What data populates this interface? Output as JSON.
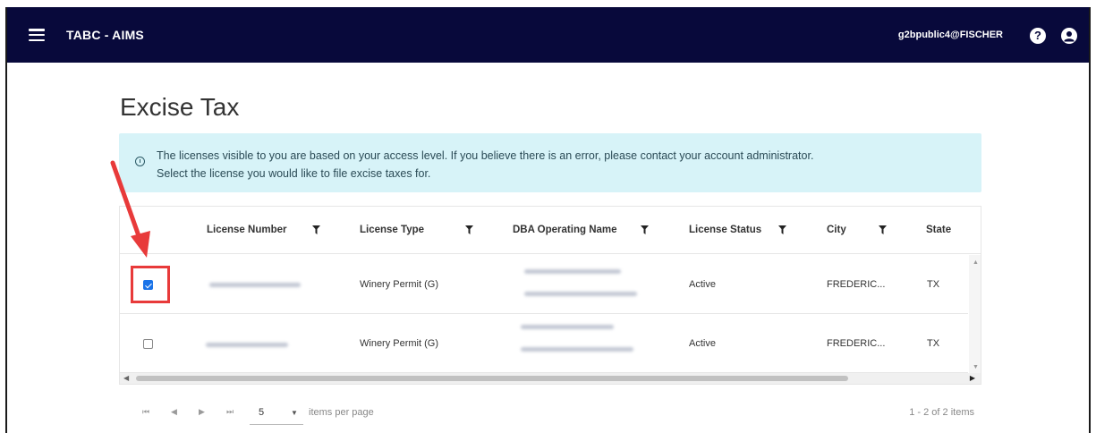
{
  "header": {
    "app_title": "TABC - AIMS",
    "user": "g2bpublic4@FISCHER",
    "background_color": "#08093b"
  },
  "page": {
    "title": "Excise Tax"
  },
  "info": {
    "line1": "The licenses visible to you are based on your access level. If you believe there is an error, please contact your account administrator.",
    "line2": "Select the license you would like to file excise taxes for.",
    "background_color": "#d7f3f8"
  },
  "table": {
    "columns": [
      "License Number",
      "License Type",
      "DBA Operating Name",
      "License Status",
      "City",
      "State"
    ],
    "rows": [
      {
        "checked": true,
        "license_type": "Winery Permit (G)",
        "license_status": "Active",
        "city": "FREDERIC...",
        "state": "TX"
      },
      {
        "checked": false,
        "license_type": "Winery Permit (G)",
        "license_status": "Active",
        "city": "FREDERIC...",
        "state": "TX"
      }
    ]
  },
  "pager": {
    "page_size": "5",
    "items_per_page_label": "items per page",
    "range_label": "1 - 2 of 2 items"
  },
  "annotation": {
    "highlight_color": "#e83a3a"
  }
}
